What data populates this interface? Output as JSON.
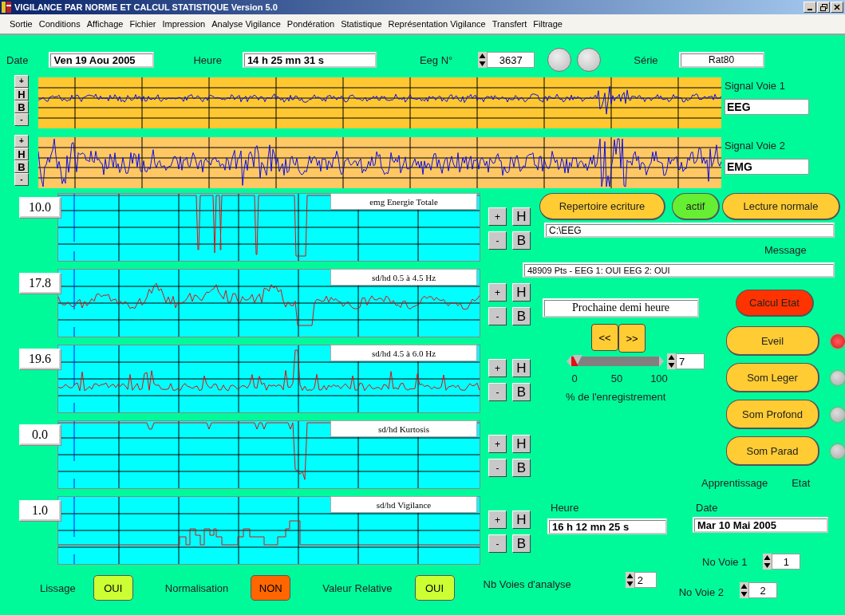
{
  "window": {
    "title": "VIGILANCE PAR NORME ET CALCUL STATISTIQUE Version 5.0"
  },
  "menu": [
    "Sortie",
    "Conditions",
    "Affichage",
    "Fichier",
    "Impression",
    "Analyse Vigilance",
    "Pondération",
    "Statistique",
    "Représentation Vigilance",
    "Transfert",
    "Filtrage"
  ],
  "header": {
    "date_label": "Date",
    "date": "Ven 19 Aou 2005",
    "time_label": "Heure",
    "time": "14 h 25 mn 31 s",
    "eeg_label": "Eeg N°",
    "eeg": "3637",
    "series_label": "Série",
    "series": "Rat80"
  },
  "signals": [
    {
      "label": "Signal Voie 1",
      "type": "EEG",
      "buttons": [
        "+",
        "H",
        "B",
        "-"
      ],
      "kind": "eeg"
    },
    {
      "label": "Signal Voie 2",
      "type": "EMG",
      "buttons": [
        "+",
        "H",
        "B",
        "-"
      ],
      "kind": "emg"
    }
  ],
  "charts": [
    {
      "value": "10.0",
      "title": "emg Energie Totale",
      "kind": "drops",
      "buttons": [
        "+",
        "H",
        "-",
        "B"
      ]
    },
    {
      "value": "17.8",
      "title": "sd/hd 0.5 à 4.5 Hz",
      "kind": "wave",
      "buttons": [
        "+",
        "H",
        "-",
        "B"
      ]
    },
    {
      "value": "19.6",
      "title": "sd/hd 4.5 à 6.0 Hz",
      "kind": "peaks",
      "buttons": [
        "+",
        "H",
        "-",
        "B"
      ]
    },
    {
      "value": "0.0",
      "title": "sd/hd Kurtosis",
      "kind": "dips",
      "buttons": [
        "+",
        "H",
        "-",
        "B"
      ]
    },
    {
      "value": "1.0",
      "title": "sd/hd Vigilance",
      "kind": "steps",
      "buttons": [
        "+",
        "H",
        "-",
        "B"
      ]
    }
  ],
  "panel": {
    "directory_button": "Repertoire ecriture",
    "active_button": "actif",
    "read_button": "Lecture normale",
    "path": "C:\\EEG",
    "message_label": "Message",
    "message": "48909 Pts - EEG 1: OUI EEG 2: OUI",
    "compute_button": "Calcul Etat",
    "next_field": "Prochaine demi heure",
    "prev_button": "<<",
    "next_button": ">>",
    "slider": {
      "level": 0.07,
      "ticks": [
        "0",
        "50",
        "100"
      ],
      "value": "7",
      "caption": "% de l'enregistrement"
    },
    "states": [
      {
        "label": "Eveil",
        "on": true
      },
      {
        "label": "Som Leger",
        "on": false
      },
      {
        "label": "Som Profond",
        "on": false
      },
      {
        "label": "Som Parad",
        "on": false
      }
    ],
    "learning_label": "Apprentissage",
    "state_label": "Etat",
    "time_label": "Heure",
    "time": "16 h 12 mn 25 s",
    "date_label": "Date",
    "date": "Mar 10 Mai 2005",
    "channel1_label": "No Voie 1",
    "channel1": "1",
    "channel2_label": "No Voie 2",
    "channel2": "2"
  },
  "toggles": [
    {
      "label": "Lissage",
      "value": "OUI",
      "on": true
    },
    {
      "label": "Normalisation",
      "value": "NON",
      "on": false
    },
    {
      "label": "Valeur Relative",
      "value": "OUI",
      "on": true
    }
  ],
  "channels_count": {
    "label": "Nb Voies d'analyse",
    "value": "2"
  }
}
